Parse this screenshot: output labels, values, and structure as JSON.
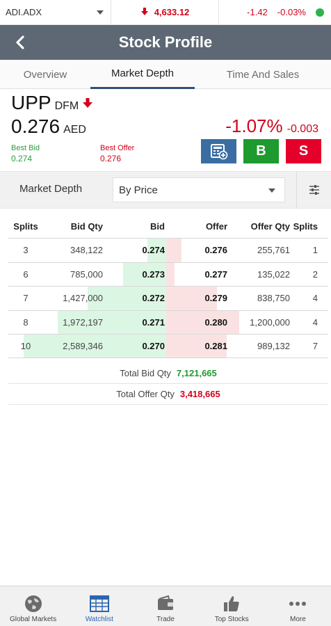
{
  "ticker": {
    "index_name": "ADI.ADX",
    "index_value": "4,633.12",
    "change": "-1.42",
    "change_pct": "-0.03%"
  },
  "header": {
    "title": "Stock Profile"
  },
  "tabs": [
    {
      "label": "Overview"
    },
    {
      "label": "Market Depth",
      "active": true
    },
    {
      "label": "Time And Sales"
    }
  ],
  "stock": {
    "symbol": "UPP",
    "exchange": "DFM",
    "price": "0.276",
    "currency": "AED",
    "change_pct": "-1.07%",
    "change": "-0.003",
    "best_bid_label": "Best Bid",
    "best_bid": "0.274",
    "best_offer_label": "Best Offer",
    "best_offer": "0.276",
    "buy_label": "B",
    "sell_label": "S"
  },
  "selector": {
    "label": "Market Depth",
    "value": "By Price"
  },
  "depth": {
    "headers": [
      "Splits",
      "Bid Qty",
      "Bid",
      "Offer",
      "Offer Qty",
      "Splits"
    ],
    "rows": [
      {
        "bid_splits": "3",
        "bid_qty": "348,122",
        "bid": "0.274",
        "offer": "0.276",
        "offer_qty": "255,761",
        "offer_splits": "1",
        "bid_fill": 0.134,
        "offer_fill": 0.213
      },
      {
        "bid_splits": "6",
        "bid_qty": "785,000",
        "bid": "0.273",
        "offer": "0.277",
        "offer_qty": "135,022",
        "offer_splits": "2",
        "bid_fill": 0.303,
        "offer_fill": 0.113
      },
      {
        "bid_splits": "7",
        "bid_qty": "1,427,000",
        "bid": "0.272",
        "offer": "0.279",
        "offer_qty": "838,750",
        "offer_splits": "4",
        "bid_fill": 0.551,
        "offer_fill": 0.699
      },
      {
        "bid_splits": "8",
        "bid_qty": "1,972,197",
        "bid": "0.271",
        "offer": "0.280",
        "offer_qty": "1,200,000",
        "offer_splits": "4",
        "bid_fill": 0.762,
        "offer_fill": 1.0
      },
      {
        "bid_splits": "10",
        "bid_qty": "2,589,346",
        "bid": "0.270",
        "offer": "0.281",
        "offer_qty": "989,132",
        "offer_splits": "7",
        "bid_fill": 1.0,
        "offer_fill": 0.824
      }
    ]
  },
  "totals": {
    "bid_label": "Total Bid Qty",
    "bid_value": "7,121,665",
    "offer_label": "Total Offer Qty",
    "offer_value": "3,418,665"
  },
  "nav": [
    {
      "label": "Global Markets",
      "icon": "globe-icon"
    },
    {
      "label": "Watchlist",
      "icon": "watchlist-icon",
      "active": true
    },
    {
      "label": "Trade",
      "icon": "wallet-icon"
    },
    {
      "label": "Top Stocks",
      "icon": "thumbs-up-icon"
    },
    {
      "label": "More",
      "icon": "more-icon"
    }
  ],
  "colors": {
    "header_bg": "#5d6874",
    "positive": "#1e9a2e",
    "negative": "#d0021b",
    "bid_bar": "#dcf6e4",
    "offer_bar": "#fbe2e2",
    "accent": "#2a66b0"
  }
}
